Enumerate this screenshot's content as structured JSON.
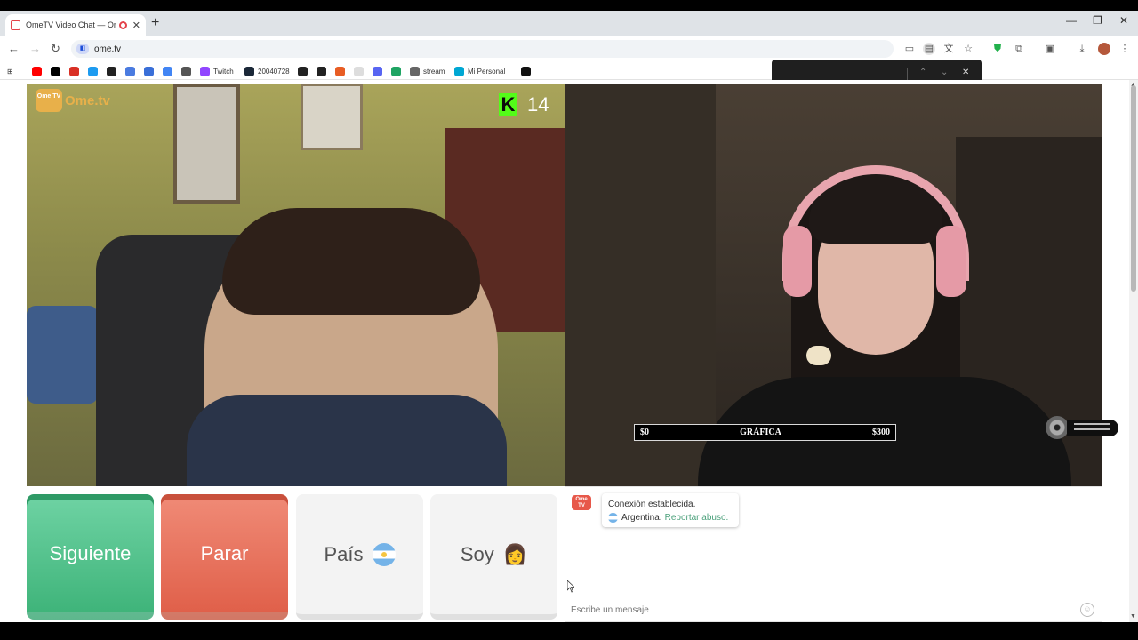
{
  "browser": {
    "tab_title": "OmeTV Video Chat — Ome",
    "tab_close": "✕",
    "new_tab": "+",
    "url": "ome.tv",
    "window_controls": [
      "—",
      "❐",
      "✕"
    ]
  },
  "bookmarks": [
    {
      "label": "",
      "icon": "youtube-icon",
      "color": "#ff0000"
    },
    {
      "label": "",
      "icon": "x-icon",
      "color": "#000000"
    },
    {
      "label": "",
      "icon": "gmail-icon",
      "color": "#d93025"
    },
    {
      "label": "",
      "icon": "edge-icon",
      "color": "#1d9bf0"
    },
    {
      "label": "",
      "icon": "roblox-icon",
      "color": "#222222"
    },
    {
      "label": "",
      "icon": "sparkle-icon",
      "color": "#4a7be0"
    },
    {
      "label": "",
      "icon": "bird-icon",
      "color": "#3a6fd8"
    },
    {
      "label": "",
      "icon": "google-icon",
      "color": "#4285f4"
    },
    {
      "label": "",
      "icon": "apple-icon",
      "color": "#555555"
    },
    {
      "label": "Twitch",
      "icon": "twitch-icon",
      "color": "#9146ff"
    },
    {
      "label": "20040728",
      "icon": "steam-icon",
      "color": "#1b2838"
    },
    {
      "label": "",
      "icon": "openai-icon",
      "color": "#222222"
    },
    {
      "label": "",
      "icon": "pen-icon",
      "color": "#222222"
    },
    {
      "label": "",
      "icon": "flame-icon",
      "color": "#e85d24"
    },
    {
      "label": "",
      "icon": "circle-icon",
      "color": "#dddddd"
    },
    {
      "label": "",
      "icon": "discord-icon",
      "color": "#5865f2"
    },
    {
      "label": "",
      "icon": "drive-icon",
      "color": "#1fa463"
    },
    {
      "label": "stream",
      "icon": "folder-icon",
      "color": "#666666"
    },
    {
      "label": "Mi Personal",
      "icon": "personal-icon",
      "color": "#00a7d3"
    },
    {
      "label": "",
      "icon": "tiktok-icon",
      "color": "#111111"
    }
  ],
  "find_bar": {
    "up": "⌃",
    "down": "⌄",
    "close": "✕"
  },
  "stream": {
    "logo_mark": "Ome TV",
    "logo_text": "Ome.tv",
    "kick_letter": "K",
    "viewer_count": "14"
  },
  "overlay": {
    "left_value": "$0",
    "center_label": "GRÁFICA",
    "right_value": "$300"
  },
  "controls": {
    "next": "Siguiente",
    "stop": "Parar",
    "country": "País",
    "gender": "Soy",
    "gender_emoji": "👩"
  },
  "chat": {
    "logo": "Ome TV",
    "status": "Conexión establecida.",
    "country": "Argentina.",
    "report": "Reportar abuso.",
    "placeholder": "Escribe un mensaje"
  }
}
